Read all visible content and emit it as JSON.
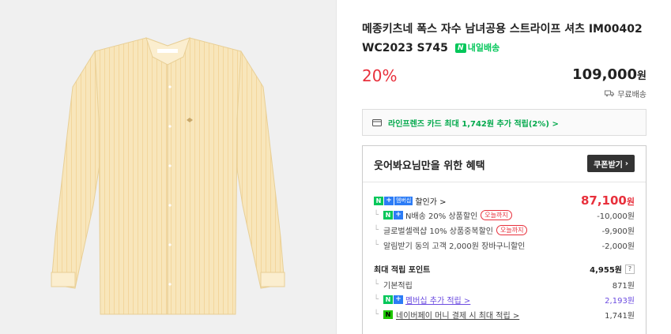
{
  "product": {
    "title": "메종키츠네 폭스 자수 남녀공용 스트라이프 셔츠 IM00402 WC2023 S745",
    "delivery_badge": "내일배송",
    "discount_rate": "20%",
    "price": "109,000",
    "price_unit": "원",
    "shipping": "무료배송"
  },
  "card_banner": {
    "text": "라인프렌즈 카드 최대 1,742원 추가 적립(2%) >"
  },
  "benefit": {
    "heading": "웃어봐요님만을 위한 혜택",
    "coupon_button": "쿠폰받기",
    "member_badge": "멤버십",
    "sale_price_label": "할인가 >",
    "sale_price": "87,100",
    "sale_price_unit": "원",
    "discounts": [
      {
        "label": "N배송 20% 상품할인",
        "tag": "오늘까지",
        "value": "-10,000원"
      },
      {
        "label": "글로벌셀렉샵 10% 상품중복할인",
        "tag": "오늘까지",
        "value": "-9,900원"
      },
      {
        "label": "알림받기 동의 고객 2,000원 장바구니할인",
        "tag": "",
        "value": "-2,000원"
      }
    ],
    "points_label": "최대 적립 포인트",
    "points_value": "4,955원",
    "points_rows": [
      {
        "label": "기본적립",
        "value": "871원"
      },
      {
        "label": "멤버십 추가 적립 >",
        "value": "2,193원"
      },
      {
        "label": "네이버페이 머니 결제 시 최대 적립 >",
        "value": "1,741원"
      }
    ]
  },
  "colors": {
    "accent_red": "#e8303c",
    "naver_green": "#03c75a",
    "membership_purple": "#6b4be0",
    "shirt": "#f7e3b4"
  }
}
